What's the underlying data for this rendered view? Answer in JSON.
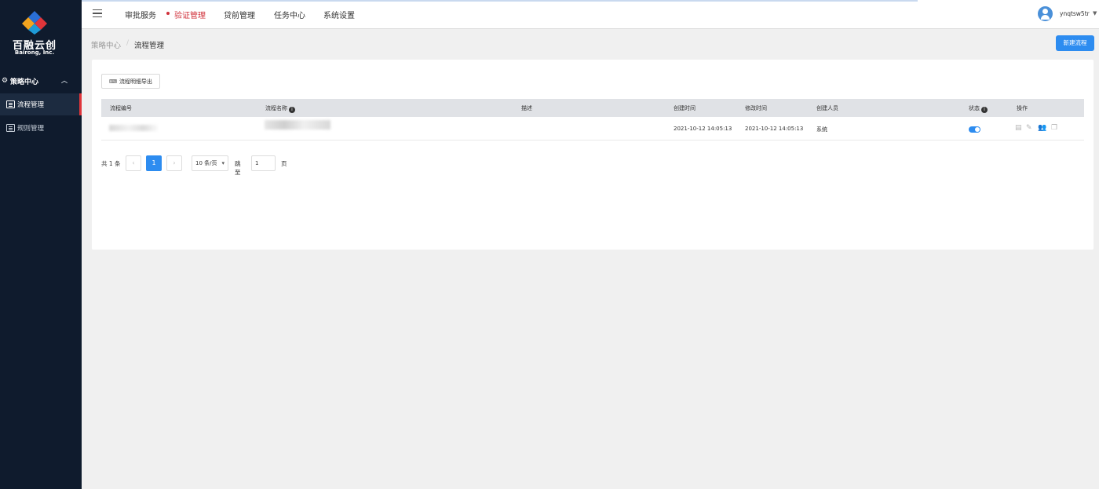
{
  "brand": {
    "name": "百融云创",
    "sub": "Bairong, Inc."
  },
  "sidebar": {
    "group_label": "策略中心",
    "items": [
      {
        "label": "流程管理",
        "active": true
      },
      {
        "label": "规则管理",
        "active": false
      }
    ]
  },
  "topnav": {
    "items": [
      "审批服务",
      "验证管理",
      "贷前管理",
      "任务中心",
      "系统设置"
    ],
    "active_index": 1,
    "username": "ynqtsw5tr"
  },
  "breadcrumb": {
    "parent": "策略中心",
    "separator": "/",
    "current": "流程管理"
  },
  "actions": {
    "new_flow": "新建流程",
    "export": "流程明细导出"
  },
  "table": {
    "columns": [
      "流程编号",
      "流程名称",
      "描述",
      "创建时间",
      "修改时间",
      "创建人员",
      "状态",
      "操作"
    ],
    "rows": [
      {
        "id": "",
        "name": "",
        "desc": "",
        "created": "2021-10-12 14:05:13",
        "modified": "2021-10-12 14:05:13",
        "creator": "系统",
        "enabled": true
      }
    ]
  },
  "pagination": {
    "total": "共 1 条",
    "prev": "‹",
    "current_page": "1",
    "next": "›",
    "page_size": "10 条/页",
    "goto_label": "跳至",
    "goto_value": "1",
    "page_unit": "页"
  },
  "colors": {
    "accent": "#2d8cf0",
    "active_nav": "#d0303a",
    "sidebar_bg": "#0f1b2d"
  },
  "icons": {
    "menu": "hamburger-icon",
    "view": "file-icon",
    "edit": "edit-icon",
    "users": "users-icon",
    "copy": "copy-icon"
  }
}
